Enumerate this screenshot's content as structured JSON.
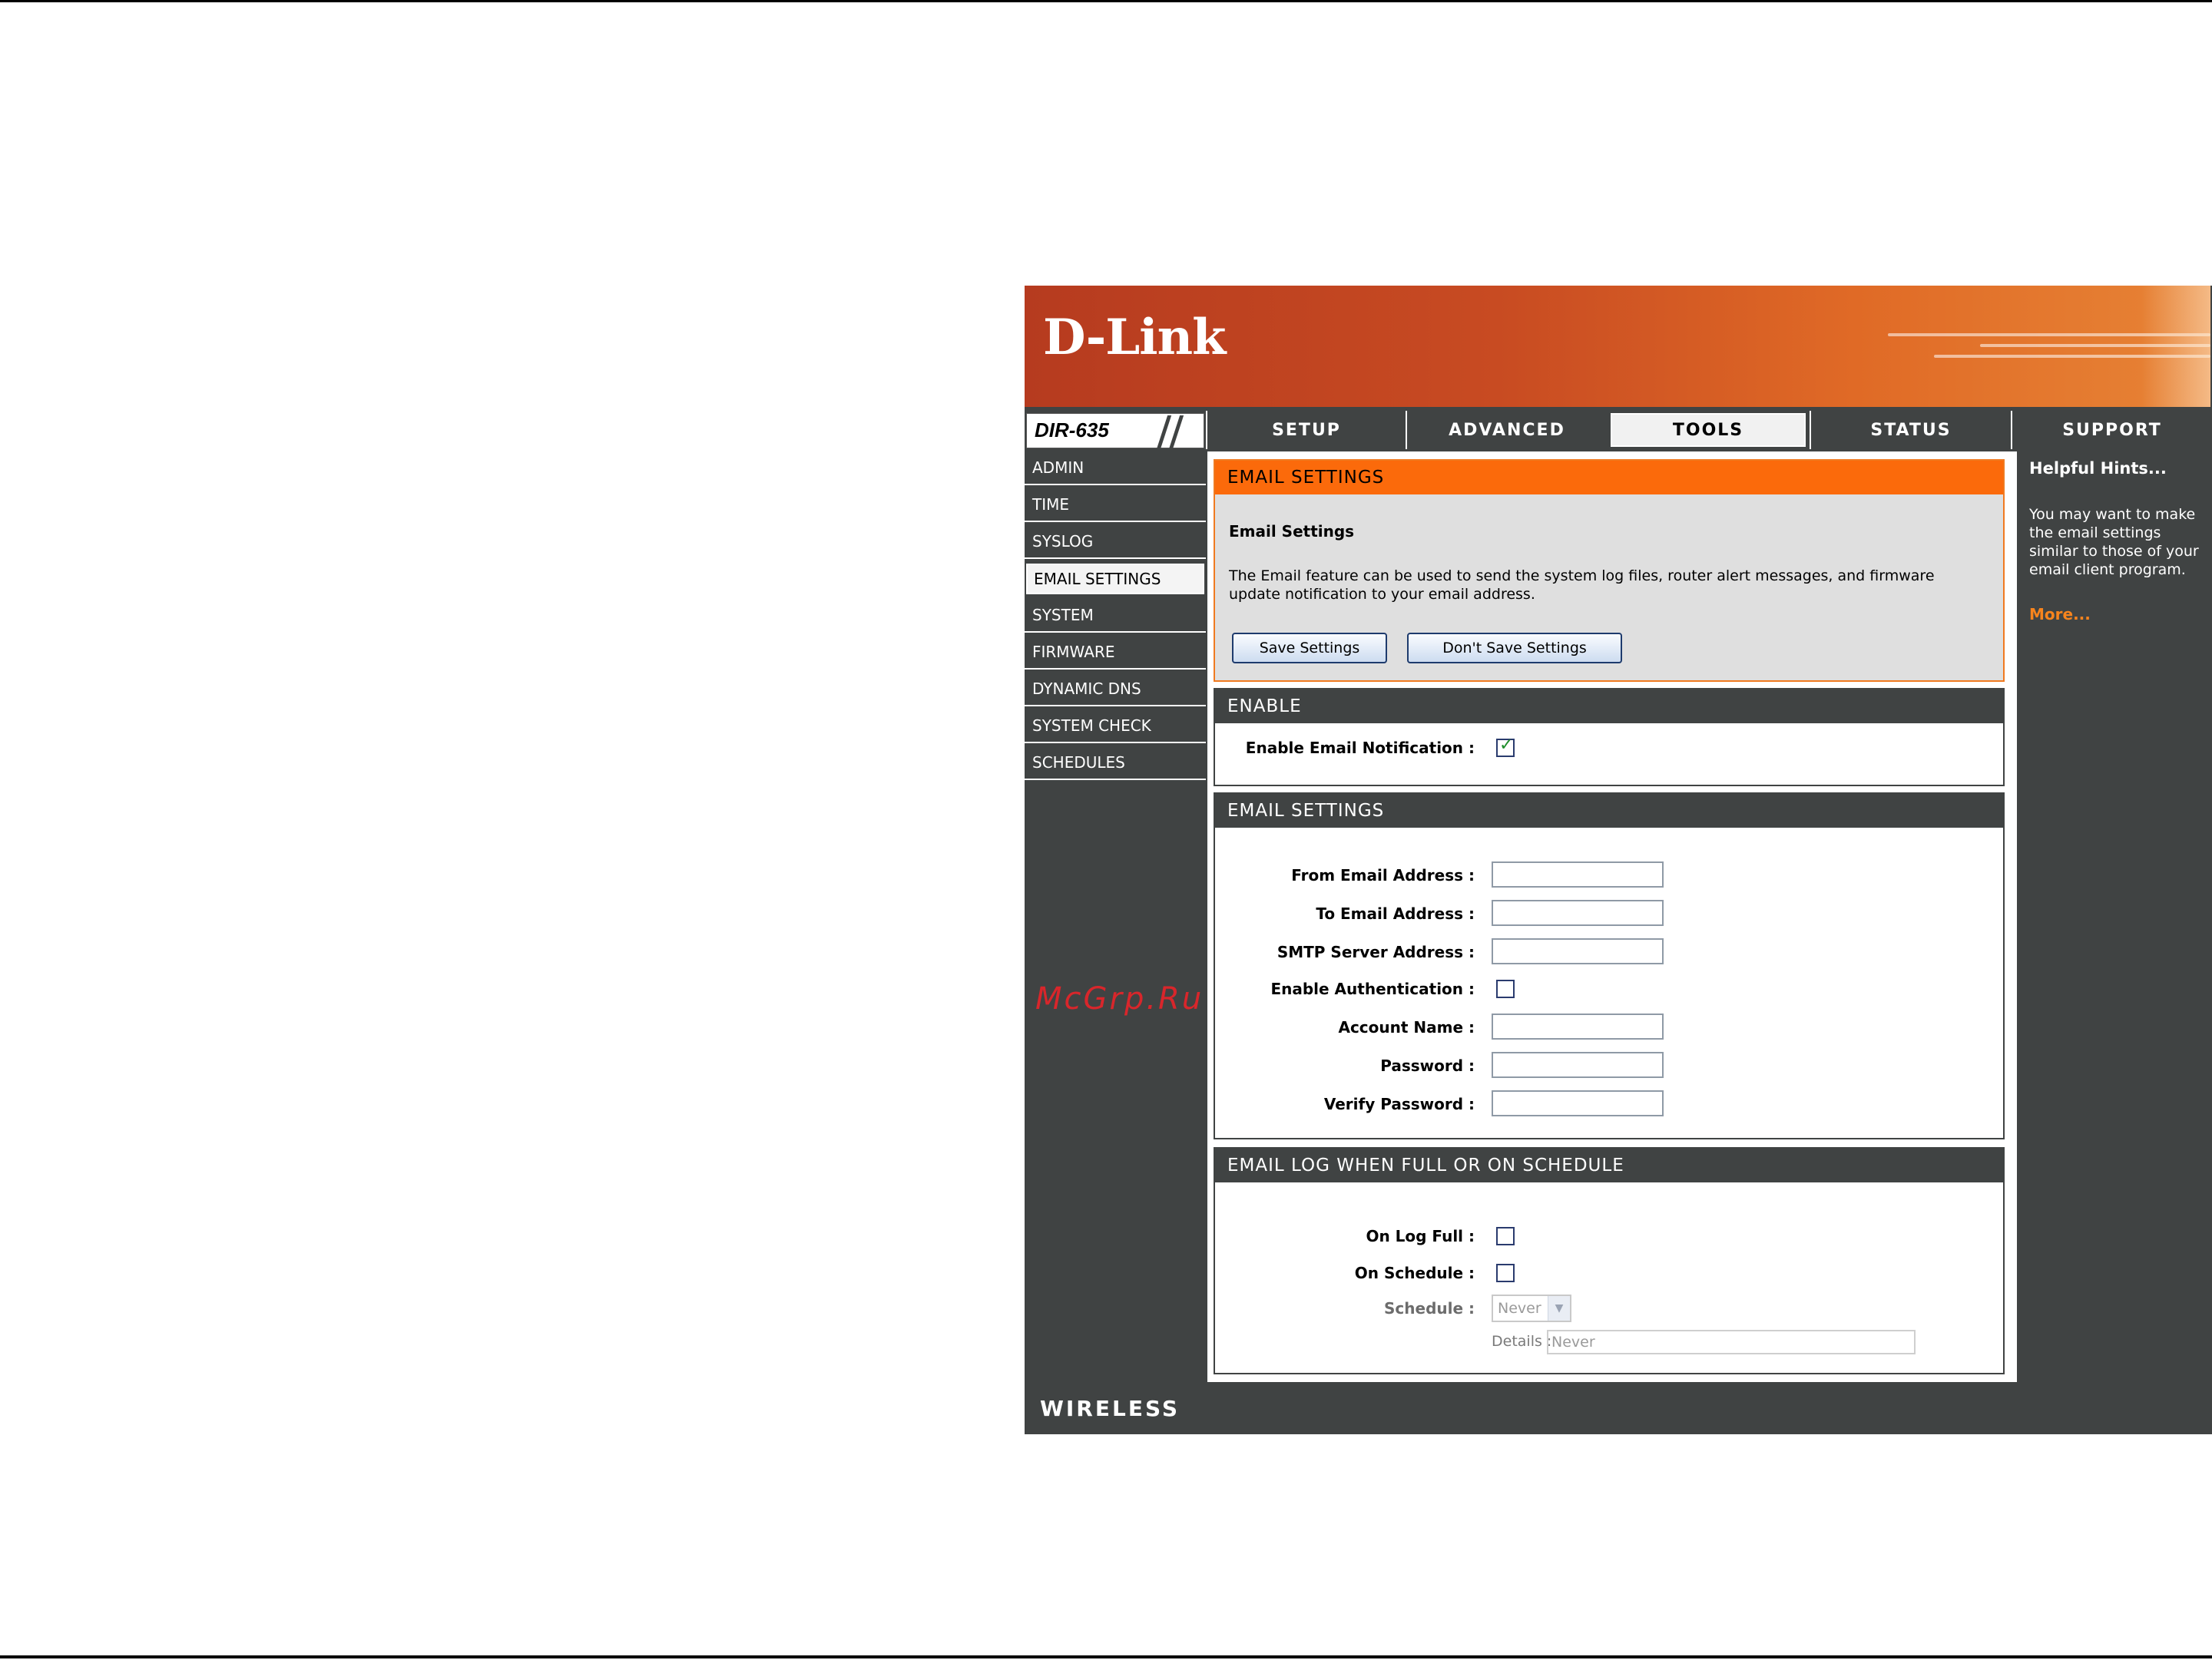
{
  "header": {
    "brand": "D-Link",
    "model": "DIR-635"
  },
  "nav": {
    "tabs": [
      "SETUP",
      "ADVANCED",
      "TOOLS",
      "STATUS",
      "SUPPORT"
    ],
    "active": "TOOLS"
  },
  "sidebar": {
    "items": [
      "ADMIN",
      "TIME",
      "SYSLOG",
      "EMAIL SETTINGS",
      "SYSTEM",
      "FIRMWARE",
      "DYNAMIC DNS",
      "SYSTEM CHECK",
      "SCHEDULES"
    ],
    "active": "EMAIL SETTINGS",
    "watermark": "McGrp.Ru"
  },
  "intro": {
    "header": "EMAIL SETTINGS",
    "title": "Email Settings",
    "description": "The Email feature can be used to send the system log files, router alert messages, and firmware update notification to your email address.",
    "save_label": "Save Settings",
    "dont_save_label": "Don't Save Settings"
  },
  "enable": {
    "header": "ENABLE",
    "label": "Enable Email Notification :",
    "checked": true
  },
  "email": {
    "header": "EMAIL SETTINGS",
    "from_label": "From Email Address :",
    "to_label": "To Email Address :",
    "smtp_label": "SMTP Server Address :",
    "auth_label": "Enable Authentication :",
    "account_label": "Account Name :",
    "password_label": "Password :",
    "verify_label": "Verify Password :"
  },
  "log": {
    "header": "EMAIL LOG WHEN FULL OR ON SCHEDULE",
    "logfull_label": "On Log Full :",
    "onschedule_label": "On Schedule :",
    "schedule_label": "Schedule :",
    "schedule_value": "Never",
    "details_label": "Details :",
    "details_value": "Never"
  },
  "hints": {
    "title": "Helpful Hints...",
    "body": "You may want to make the email settings similar to those of your email client program.",
    "more": "More..."
  },
  "footer": {
    "brand": "WIRELESS"
  },
  "colors": {
    "accent": "#fb6a0b",
    "dark": "#404343",
    "link": "#f7841d"
  }
}
